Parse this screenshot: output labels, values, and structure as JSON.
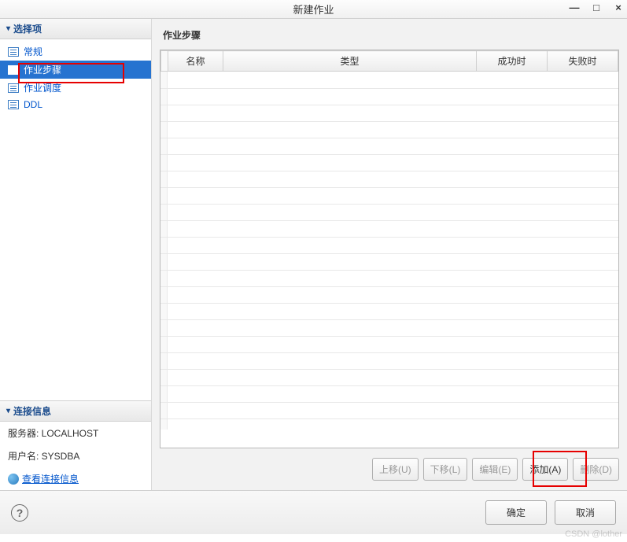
{
  "title": "新建作业",
  "window_controls": {
    "min": "—",
    "max": "□",
    "close": "×"
  },
  "sidebar": {
    "section1_title": "选择项",
    "items": [
      {
        "label": "常规"
      },
      {
        "label": "作业步骤"
      },
      {
        "label": "作业调度"
      },
      {
        "label": "DDL"
      }
    ],
    "section2_title": "连接信息",
    "server_label": "服务器: LOCALHOST",
    "user_label": "用户名: SYSDBA",
    "conn_link": "查看连接信息"
  },
  "content": {
    "heading": "作业步骤",
    "columns": {
      "name": "名称",
      "type": "类型",
      "success": "成功时",
      "fail": "失败时"
    },
    "actions": {
      "up": "上移(U)",
      "down": "下移(L)",
      "edit": "编辑(E)",
      "add": "添加(A)",
      "delete": "删除(D)"
    }
  },
  "footer": {
    "help": "?",
    "ok": "确定",
    "cancel": "取消"
  },
  "watermark": "CSDN @lother"
}
